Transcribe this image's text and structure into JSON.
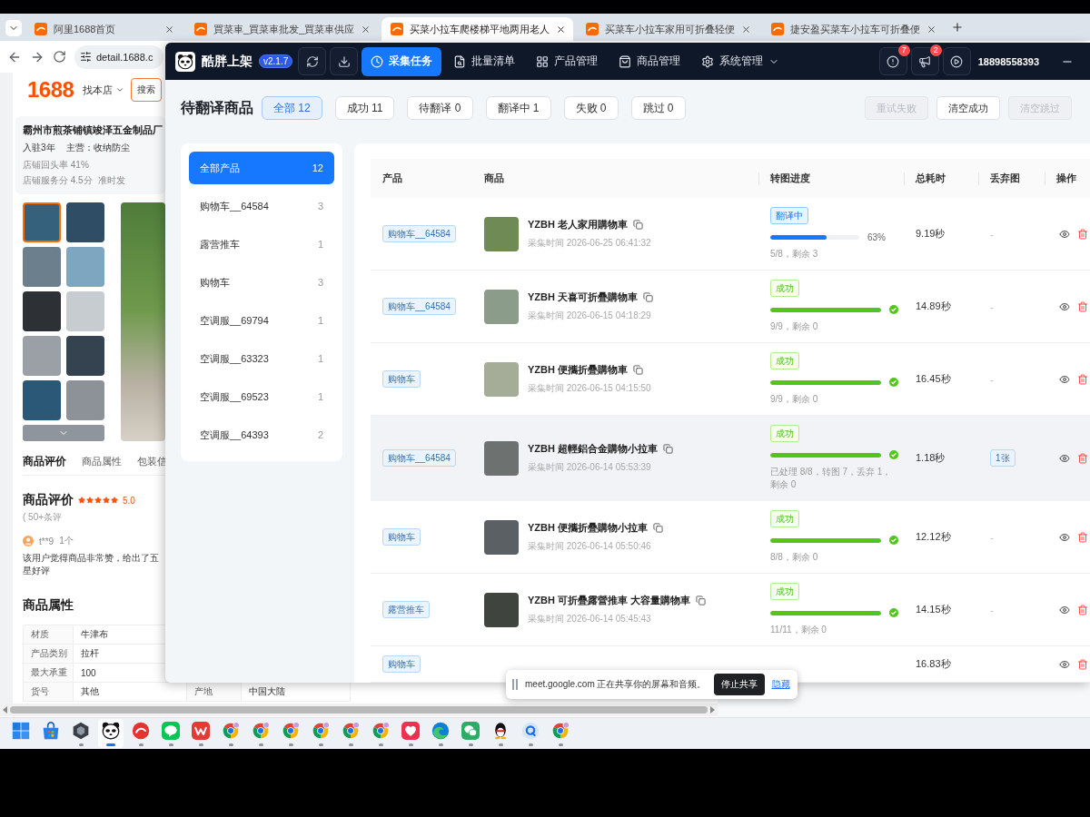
{
  "browser": {
    "tabs": [
      {
        "title": "阿里1688首页",
        "selected": false
      },
      {
        "title": "買菜車_買菜車批发_買菜車供应",
        "selected": false
      },
      {
        "title": "买菜小拉车爬楼梯平地两用老人",
        "selected": true
      },
      {
        "title": "买菜车小拉车家用可折叠轻便",
        "selected": false
      },
      {
        "title": "捷安盈买菜车小拉车可折叠便",
        "selected": false
      }
    ],
    "address": "detail.1688.c"
  },
  "page": {
    "logo": "1688",
    "store_picker": "找本店",
    "search": "搜索",
    "store": {
      "name": "霸州市煎茶铺镇竣泽五金制品厂",
      "meta": [
        "入驻3年",
        "主营：收纳防尘"
      ],
      "stats": [
        "店铺回头率 41%",
        "店铺服务分 4.5分",
        "准时发"
      ]
    },
    "gallery": [
      {
        "selected": true
      },
      {
        "selected": false
      },
      {
        "selected": false
      },
      {
        "selected": false
      },
      {
        "selected": false
      },
      {
        "selected": false
      },
      {
        "selected": false
      },
      {
        "selected": false
      },
      {
        "selected": false
      },
      {
        "selected": false
      }
    ],
    "tabs": [
      {
        "label": "商品评价",
        "selected": true
      },
      {
        "label": "商品属性",
        "selected": false
      },
      {
        "label": "包装信",
        "selected": false
      }
    ],
    "reviews": {
      "title": "商品评价",
      "stars": 5,
      "score": "5.0",
      "count": "( 50+条评",
      "reviewer": "t**9",
      "reviewer_count": "1个",
      "comment": "该用户觉得商品非常赞，给出了五星好评"
    },
    "attributes": {
      "title": "商品属性",
      "rows": [
        {
          "name": "材质",
          "value": "牛津布"
        },
        {
          "name": "产品类别",
          "value": "拉杆"
        },
        {
          "name": "最大承重",
          "value": "100"
        },
        {
          "name": "货号",
          "value": "其他",
          "name_2": "产地",
          "value_2": "中国大陆"
        }
      ]
    }
  },
  "app": {
    "name": "酷胖上架",
    "version": "v2.1.7",
    "tools": [
      {
        "kind": "refresh"
      },
      {
        "kind": "download"
      }
    ],
    "nav": [
      {
        "label": "采集任务",
        "kind": "clock",
        "selected": true,
        "dropdown": false
      },
      {
        "label": "批量清单",
        "kind": "list",
        "selected": false,
        "dropdown": false
      },
      {
        "label": "产品管理",
        "kind": "grid",
        "selected": false,
        "dropdown": false
      },
      {
        "label": "商品管理",
        "kind": "bag",
        "selected": false,
        "dropdown": false
      },
      {
        "label": "系统管理",
        "kind": "gear",
        "selected": false,
        "dropdown": true
      }
    ],
    "alerts": [
      {
        "kind": "alert",
        "count": "7"
      },
      {
        "kind": "megaphone",
        "count": "2"
      },
      {
        "kind": "play"
      }
    ],
    "account": "18898558393",
    "title": "待翻译商品",
    "filters": [
      {
        "label": "全部 12",
        "selected": true
      },
      {
        "label": "成功 11",
        "selected": false
      },
      {
        "label": "待翻译 0",
        "selected": false
      },
      {
        "label": "翻译中 1",
        "selected": false
      },
      {
        "label": "失败 0",
        "selected": false
      },
      {
        "label": "跳过 0",
        "selected": false
      }
    ],
    "actions": [
      {
        "label": "重试失败",
        "disabled": true
      },
      {
        "label": "清空成功",
        "disabled": false
      },
      {
        "label": "清空跳过",
        "disabled": true
      }
    ],
    "categories": [
      {
        "name": "全部产品",
        "count": "12",
        "selected": true
      },
      {
        "name": "购物车__64584",
        "count": "3",
        "selected": false
      },
      {
        "name": "露营推车",
        "count": "1",
        "selected": false
      },
      {
        "name": "购物车",
        "count": "3",
        "selected": false
      },
      {
        "name": "空调服__69794",
        "count": "1",
        "selected": false
      },
      {
        "name": "空调服__63323",
        "count": "1",
        "selected": false
      },
      {
        "name": "空调服__69523",
        "count": "1",
        "selected": false
      },
      {
        "name": "空调服__64393",
        "count": "2",
        "selected": false
      }
    ],
    "table": {
      "columns": [
        "产品",
        "商品",
        "转图进度",
        "总耗时",
        "丢弃图",
        "操作"
      ],
      "rows": [
        {
          "product": "购物车__64584",
          "title": "YZBH 老人家用購物車",
          "collected": "采集时间 2026-06-25 06:41:32",
          "status": {
            "label": "翻译中",
            "kind": "running"
          },
          "level": 0.63,
          "percent": "63%",
          "progress": "5/8，剩余 3",
          "duration": "9.19秒",
          "discarded": {
            "kind": "none",
            "text": "-"
          },
          "highlighted": false
        },
        {
          "product": "购物车__64584",
          "title": "YZBH 天喜可折疊購物車",
          "collected": "采集时间 2026-06-15 04:18:29",
          "status": {
            "label": "成功",
            "kind": "success"
          },
          "level": 1,
          "progress": "9/9，剩余 0",
          "duration": "14.89秒",
          "discarded": {
            "kind": "none",
            "text": "-"
          },
          "highlighted": false
        },
        {
          "product": "购物车",
          "title": "YZBH 便攜折疊購物車",
          "collected": "采集时间 2026-06-15 04:15:50",
          "status": {
            "label": "成功",
            "kind": "success"
          },
          "level": 1,
          "progress": "9/9，剩余 0",
          "duration": "16.45秒",
          "discarded": {
            "kind": "none",
            "text": "-"
          },
          "highlighted": false
        },
        {
          "product": "购物车__64584",
          "title": "YZBH 超輕鋁合金購物小拉車",
          "collected": "采集时间 2026-06-14 05:53:39",
          "status": {
            "label": "成功",
            "kind": "success"
          },
          "level": 1,
          "progress": "已处理 8/8，转图 7，丢弃 1，剩余 0",
          "duration": "1.18秒",
          "discarded": {
            "kind": "tag",
            "text": "1张"
          },
          "highlighted": true
        },
        {
          "product": "购物车",
          "title": "YZBH 便攜折疊購物小拉車",
          "collected": "采集时间 2026-06-14 05:50:46",
          "status": {
            "label": "成功",
            "kind": "success"
          },
          "level": 1,
          "progress": "8/8，剩余 0",
          "duration": "12.12秒",
          "discarded": {
            "kind": "none",
            "text": "-"
          },
          "highlighted": false
        },
        {
          "product": "露营推车",
          "title": "YZBH 可折疊露營推車 大容量購物車",
          "collected": "采集时间 2026-06-14 05:45:43",
          "status": {
            "label": "成功",
            "kind": "success"
          },
          "level": 1,
          "progress": "11/11，剩余 0",
          "duration": "14.15秒",
          "discarded": {
            "kind": "none",
            "text": "-"
          },
          "highlighted": false
        },
        {
          "product": "购物车",
          "duration": "16.83秒",
          "highlighted": false
        }
      ]
    }
  },
  "share_bar": {
    "message": "meet.google.com 正在共享你的屏幕和音频。",
    "stop": "停止共享",
    "hide": "隐藏"
  },
  "taskbar": [
    {
      "kind": "start",
      "running": false,
      "selected": false
    },
    {
      "kind": "store",
      "running": false,
      "selected": false
    },
    {
      "kind": "hexagon",
      "running": true,
      "selected": false
    },
    {
      "kind": "panda",
      "running": true,
      "selected": true
    },
    {
      "kind": "swoosh",
      "running": true,
      "selected": false
    },
    {
      "kind": "line",
      "running": true,
      "selected": false
    },
    {
      "kind": "zigzag",
      "running": true,
      "selected": false
    },
    {
      "kind": "ring",
      "running": true,
      "selected": false
    },
    {
      "kind": "ring",
      "running": true,
      "selected": false
    },
    {
      "kind": "ring",
      "running": true,
      "selected": false
    },
    {
      "kind": "ring",
      "running": true,
      "selected": false
    },
    {
      "kind": "ring",
      "running": true,
      "selected": false
    },
    {
      "kind": "ring",
      "running": true,
      "selected": false
    },
    {
      "kind": "heart",
      "running": true,
      "selected": false
    },
    {
      "kind": "swirl",
      "running": true,
      "selected": false
    },
    {
      "kind": "bubbles",
      "running": true,
      "selected": false
    },
    {
      "kind": "penguin",
      "running": true,
      "selected": false
    },
    {
      "kind": "ringtile",
      "running": true,
      "selected": false
    },
    {
      "kind": "ring",
      "running": true,
      "selected": false
    }
  ]
}
